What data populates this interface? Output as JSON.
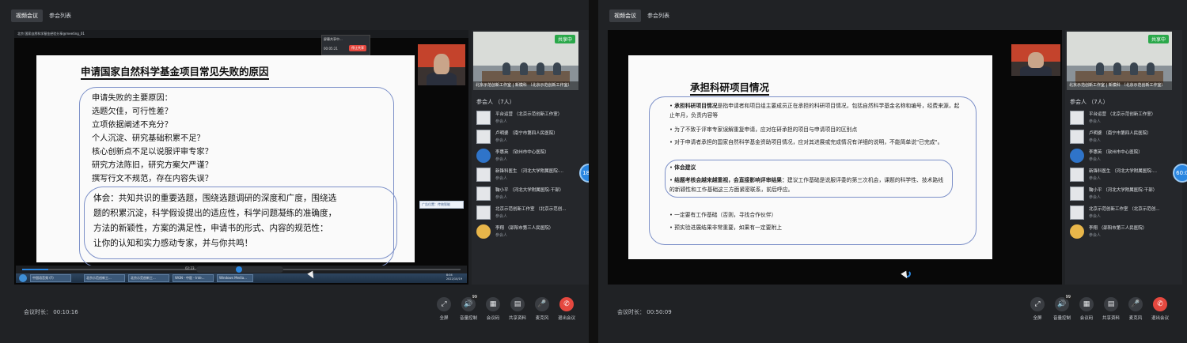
{
  "tabs": [
    {
      "label": "视频会议"
    },
    {
      "label": "参会列表"
    }
  ],
  "left": {
    "window_title": "北京 国家自然科学基金经验分享@meeting_01",
    "popup": {
      "text": "屏幕共享中...",
      "sub": "00:05:21",
      "button": "停止共享"
    },
    "slide": {
      "title": "申请国家自然科学基金项目常见失败的原因",
      "reasons": [
        "申请失败的主要原因：",
        "选题欠佳，可行性差？",
        "立项依据阐述不充分？",
        "个人沉淀、研究基础积累不足？",
        "核心创新点不足以说服评审专家？",
        "研究方法陈旧，研究方案欠严谨？",
        "撰写行文不规范，存在内容失误？"
      ],
      "insight": [
        "体会：共知共识的重要选题，围绕选题调研的深度和广度，围绕选",
        "题的积累沉淀，科学假设提出的适应性，科学问题凝练的准确度，",
        "方法的新颖性，方案的满足性，申请书的形式、内容的规范性：",
        "让你的认知和实力感动专家，并与你共鸣！"
      ]
    },
    "mini_toolbar": "广告位置：传统智能",
    "player_time": "02:23",
    "taskbar": [
      "中国语音频 (F)",
      "北京示范创新工...",
      "北京示范创新工...",
      "WGN - 中医 - Inte...",
      "Windows Media..."
    ],
    "clock": "8:04\n2022/10/19",
    "duration_label": "会议时长：",
    "duration": "00:10:16",
    "side_dot": "18:5"
  },
  "right": {
    "slide": {
      "title": "承担科研项目情况",
      "b1_bold": "承担科研项目情况",
      "b1_rest": "是指申请者和项目组主要成员正在承担的科研项目情况，包括自然科学基金名称和编号，经费来源，起止年月，负责内容等",
      "b2": "为了不致于评审专家误解重复申请，应对在研承担的项目与申请项目的区别点",
      "b3": "对于申请者承担的国家自然科学基金资助项目情况，应对其进展或完成情况有详细的说明，不能简单说\"已完成\"。",
      "box_title": "体会建议",
      "b4_bold": "结题考核会越来越重视，会直接影响评审结果：",
      "b4_rest": "建议工作基础是说服评委的第三次机会，课题的科学性、技术路线的新颖性和工作基础这三方面紧密联系，前后呼应。",
      "b5": "一定要有工作基础（否则，寻找合作伙伴）",
      "b6": "预实验进展结果非常重要，如果有一定要附上"
    },
    "duration_label": "会议时长：",
    "duration": "00:50:09",
    "side_dot": "60:0"
  },
  "sidebar": {
    "share_badge": "共享中",
    "room_caption": "北京示范创新工作室 | 新模科 （北京示范创新工作室）",
    "participants_label": "参会人 （7人）",
    "participants": [
      {
        "name": "平台运营 （北京示范创新工作室）",
        "role": "参会人",
        "avatar": "square"
      },
      {
        "name": "卢明婆 （南宁市第四人民医院）",
        "role": "参会人",
        "avatar": "square"
      },
      {
        "name": "李惠英 （钦州市中心医院）",
        "role": "参会人",
        "avatar": "round"
      },
      {
        "name": "新锋科医生 （河北大学附属医院-...",
        "role": "参会人",
        "avatar": "square"
      },
      {
        "name": "鞠小平 （河北大学附属医院-干部）",
        "role": "参会人",
        "avatar": "square"
      },
      {
        "name": "北京示范创新工作室 （北京示范创...",
        "role": "参会人",
        "avatar": "square"
      },
      {
        "name": "李翔 （邵阳市第三人民医院）",
        "role": "参会人",
        "avatar": "gold"
      }
    ]
  },
  "controls": [
    {
      "label": "全屏",
      "icon": "⤢"
    },
    {
      "label": "音量控制",
      "icon": "🔊"
    },
    {
      "label": "会议码",
      "icon": "▦"
    },
    {
      "label": "共享资料",
      "icon": "▤"
    },
    {
      "label": "麦克风",
      "icon": "🎤"
    },
    {
      "label": "退出会议",
      "icon": "✆"
    }
  ],
  "volume_badge": "99"
}
